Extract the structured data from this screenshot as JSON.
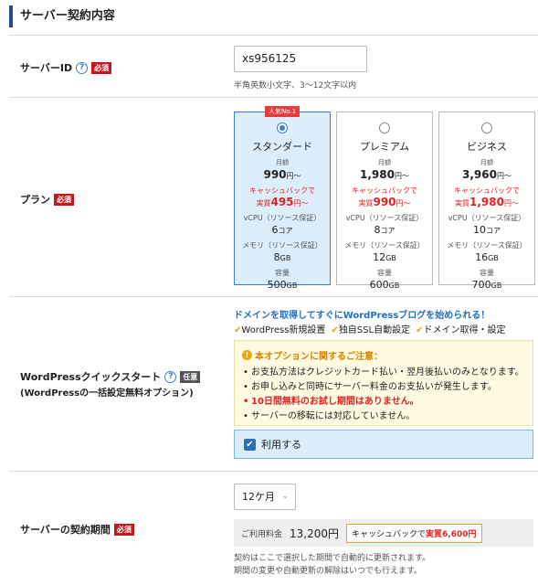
{
  "section": {
    "title": "サーバー契約内容"
  },
  "server_id": {
    "label": "サーバーID",
    "required": "必須",
    "value": "xs956125",
    "hint": "半角英数小文字、3〜12文字以内"
  },
  "plan": {
    "label": "プラン",
    "required": "必須",
    "badge": "人気No.1",
    "selected": "スタンダード",
    "items": [
      {
        "name": "スタンダード",
        "monthly_label": "月額",
        "price": "990",
        "price_unit": "円〜",
        "cashback_label": "キャッシュバックで",
        "real_label": "実質",
        "real_price": "495",
        "real_unit": "円〜",
        "cpu_label": "vCPU（リソース保証）",
        "cpu": "6",
        "cpu_unit": "コア",
        "mem_label": "メモリ（リソース保証）",
        "mem": "8",
        "mem_unit": "GB",
        "disk_label": "容量",
        "disk": "500",
        "disk_unit": "GB"
      },
      {
        "name": "プレミアム",
        "monthly_label": "月額",
        "price": "1,980",
        "price_unit": "円〜",
        "cashback_label": "キャッシュバックで",
        "real_label": "実質",
        "real_price": "990",
        "real_unit": "円〜",
        "cpu_label": "vCPU（リソース保証）",
        "cpu": "8",
        "cpu_unit": "コア",
        "mem_label": "メモリ（リソース保証）",
        "mem": "12",
        "mem_unit": "GB",
        "disk_label": "容量",
        "disk": "600",
        "disk_unit": "GB"
      },
      {
        "name": "ビジネス",
        "monthly_label": "月額",
        "price": "3,960",
        "price_unit": "円〜",
        "cashback_label": "キャッシュバックで",
        "real_label": "実質",
        "real_price": "1,980",
        "real_unit": "円〜",
        "cpu_label": "vCPU（リソース保証）",
        "cpu": "10",
        "cpu_unit": "コア",
        "mem_label": "メモリ（リソース保証）",
        "mem": "16",
        "mem_unit": "GB",
        "disk_label": "容量",
        "disk": "700",
        "disk_unit": "GB"
      }
    ]
  },
  "wordpress": {
    "label": "WordPressクイックスタート",
    "optional": "任意",
    "sublabel": "(WordPressの一括設定無料オプション)",
    "headline": "ドメインを取得してすぐにWordPressブログを始められる！",
    "features": [
      "WordPress新規設置",
      "独自SSL自動設定",
      "ドメイン取得・設定"
    ],
    "notice_title": "本オプションに関するご注意：",
    "notices": [
      "お支払方法はクレジットカード払い・翌月後払いのみとなります。",
      "お申し込みと同時にサーバー料金のお支払いが発生します。",
      "10日間無料のお試し期間はありません。",
      "サーバーの移転には対応していません。"
    ],
    "use_label": "利用する",
    "use_checked": true
  },
  "contract": {
    "label": "サーバーの契約期間",
    "required": "必須",
    "period": "12ケ月",
    "fee_label": "ご利用料金",
    "fee": "13,200円",
    "cashback_text": "キャッシュバックで",
    "cashback_real": "実質6,600円",
    "renew_note_1": "契約はここで選択した期間で自動的に更新されます。",
    "renew_note_2": "期間の変更や自動更新の解除はいつでも行えます。"
  },
  "colors": {
    "accent": "#2b4a8b",
    "link": "#3a7fd5",
    "required": "#c8161d",
    "selected_bg": "#dceefc",
    "cashback": "#e0231f"
  }
}
